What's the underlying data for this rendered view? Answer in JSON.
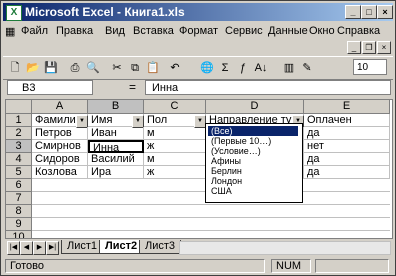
{
  "titlebar": {
    "icon": "excel-icon",
    "title": "Microsoft Excel - Книга1.xls"
  },
  "menu": [
    "Файл",
    "Правка",
    "Вид",
    "Вставка",
    "Формат",
    "Сервис",
    "Данные",
    "Окно",
    "Справка"
  ],
  "toolbar": {
    "zoom": "10"
  },
  "formula_bar": {
    "name_box": "B3",
    "equals": "=",
    "content": "Инна"
  },
  "columns": [
    "A",
    "B",
    "C",
    "D",
    "E"
  ],
  "rows": [
    "1",
    "2",
    "3",
    "4",
    "5",
    "6",
    "7",
    "8",
    "9",
    "10"
  ],
  "cells": {
    "header": [
      "Фамилия",
      "Имя",
      "Пол",
      "Направление ту",
      "Оплачен"
    ],
    "r2": [
      "Петров",
      "Иван",
      "м",
      "",
      "да"
    ],
    "r3": [
      "Смирнов",
      "Инна",
      "ж",
      "",
      "нет"
    ],
    "r4": [
      "Сидоров",
      "Василий",
      "м",
      "",
      "да"
    ],
    "r5": [
      "Козлова",
      "Ира",
      "ж",
      "",
      "да"
    ]
  },
  "dropdown": [
    "(Все)",
    "(Первые 10…)",
    "(Условие…)",
    "Афины",
    "Берлин",
    "Лондон",
    "США"
  ],
  "sheet_tabs": [
    "Лист1",
    "Лист2",
    "Лист3"
  ],
  "active_tab": "Лист2",
  "status": {
    "ready": "Готово",
    "num": "NUM"
  }
}
